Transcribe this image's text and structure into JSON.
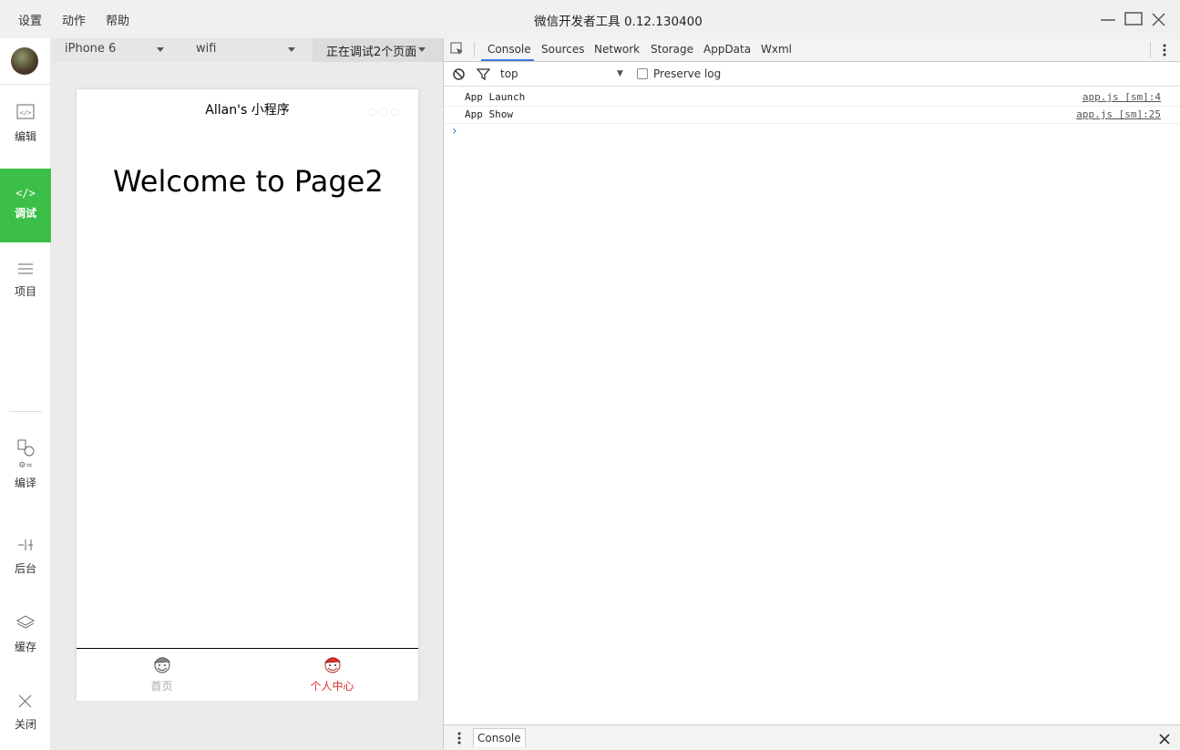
{
  "menu": {
    "settings": "设置",
    "actions": "动作",
    "help": "帮助"
  },
  "app_title": "微信开发者工具 0.12.130400",
  "sidebar": {
    "items": [
      {
        "label": "编辑",
        "icon": "code-editor-icon"
      },
      {
        "label": "调试",
        "icon": "debug-code-icon"
      },
      {
        "label": "项目",
        "icon": "menu-lines-icon"
      },
      {
        "label": "编译",
        "icon": "compile-icon"
      },
      {
        "label": "后台",
        "icon": "background-icon"
      },
      {
        "label": "缓存",
        "icon": "layers-icon"
      },
      {
        "label": "关闭",
        "icon": "close-icon"
      }
    ],
    "active_color": "#3cbf48"
  },
  "device_bar": {
    "device": "iPhone 6",
    "network": "wifi",
    "debug_pages": "正在调试2个页面"
  },
  "phone": {
    "nav_title": "Allan's 小程序",
    "content_text": "Welcome to Page2",
    "tabs": [
      {
        "label": "首页",
        "active": false,
        "icon": "santa-avatar-icon"
      },
      {
        "label": "个人中心",
        "active": true,
        "icon": "santa-avatar-red-icon"
      }
    ],
    "active_tab_color": "#e0302b"
  },
  "devtools": {
    "tabs": [
      "Console",
      "Sources",
      "Network",
      "Storage",
      "AppData",
      "Wxml"
    ],
    "active_tab": "Console",
    "context": "top",
    "preserve_log": "Preserve log",
    "logs": [
      {
        "message": "App Launch",
        "source": "app.js [sm]:4"
      },
      {
        "message": "App Show",
        "source": "app.js [sm]:25"
      }
    ],
    "prompt": "›",
    "drawer_tab": "Console"
  }
}
